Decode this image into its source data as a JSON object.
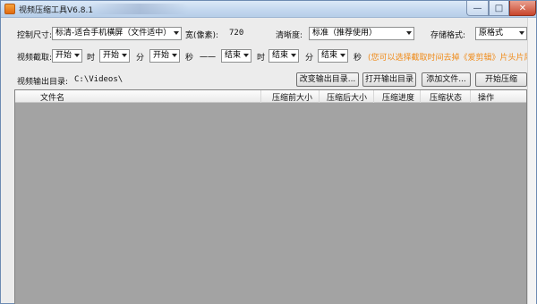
{
  "window": {
    "title": "视频压缩工具V6.8.1",
    "controls": {
      "minimize": "—",
      "maximize": "□",
      "close": "✕"
    }
  },
  "row1": {
    "size_label": "控制尺寸:",
    "size_value": "标清-适合手机横屏（文件适中）",
    "width_label": "宽(像素):",
    "width_value": "720",
    "clarity_label": "清晰度:",
    "clarity_value": "标准（推荐使用）",
    "format_label": "存储格式:",
    "format_value": "原格式"
  },
  "row2": {
    "clip_label": "视频截取:",
    "start_hour": "开始",
    "hour_label": "时",
    "start_min": "开始",
    "min_label": "分",
    "start_sec": "开始",
    "sec_label": "秒",
    "dash": "一一",
    "end_hour": "结束",
    "hour_label2": "时",
    "end_min": "结束",
    "min_label2": "分",
    "end_sec": "结束",
    "sec_label2": "秒",
    "hint": "(您可以选择截取时间去掉《爱剪辑》片头片尾)"
  },
  "row3": {
    "output_label": "视频输出目录:",
    "output_path": "C:\\Videos\\",
    "change_dir_button": "改变输出目录...",
    "open_dir_button": "打开输出目录",
    "add_file_button": "添加文件...",
    "start_button": "开始压缩"
  },
  "list": {
    "columns": [
      "文件名",
      "压缩前大小",
      "压缩后大小",
      "压缩进度",
      "压缩状态",
      "操作"
    ],
    "rows": []
  },
  "colors": {
    "hint_orange": "#ef8b1a",
    "list_background": "#a3a3a3"
  }
}
